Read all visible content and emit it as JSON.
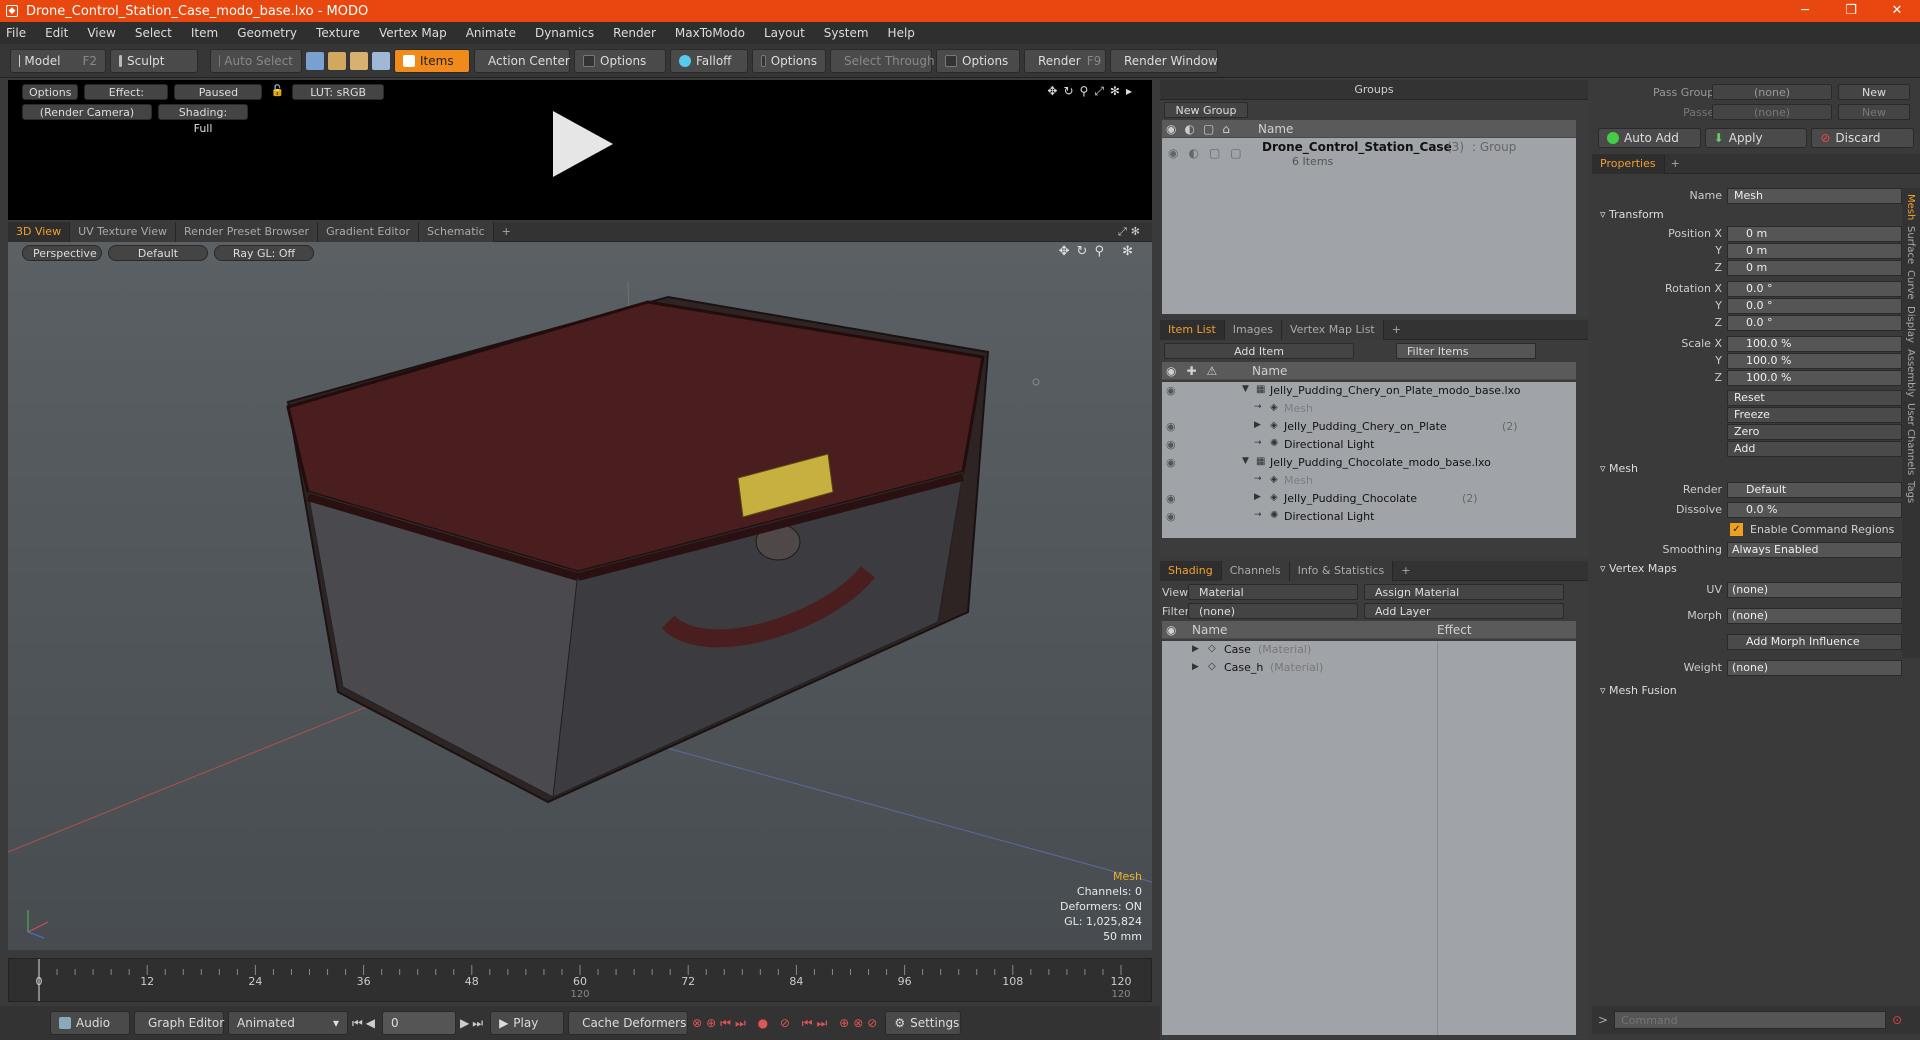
{
  "window": {
    "title": "Drone_Control_Station_Case_modo_base.lxo - MODO",
    "minimize": "─",
    "maximize": "❐",
    "close": "✕"
  },
  "menu": [
    "File",
    "Edit",
    "View",
    "Select",
    "Item",
    "Geometry",
    "Texture",
    "Vertex Map",
    "Animate",
    "Dynamics",
    "Render",
    "MaxToModo",
    "Layout",
    "System",
    "Help"
  ],
  "toolbar": {
    "model": "Model",
    "model_key": "F2",
    "sculpt": "Sculpt",
    "auto_select": "Auto Select",
    "items": "Items",
    "action_center": "Action Center",
    "options1": "Options",
    "falloff": "Falloff",
    "options2": "Options",
    "select_through": "Select Through",
    "options3": "Options",
    "render": "Render",
    "render_key": "F9",
    "render_window": "Render Window"
  },
  "preview": {
    "options": "Options",
    "effect": "Effect: (Shadi...",
    "paused": "Paused",
    "lut": "LUT: sRGB",
    "camera": "(Render Camera)",
    "shading": "Shading: Full"
  },
  "view_tabs": [
    "3D View",
    "UV Texture View",
    "Render Preset Browser",
    "Gradient Editor",
    "Schematic",
    "+"
  ],
  "viewport": {
    "perspective": "Perspective",
    "default": "Default",
    "raygl": "Ray GL: Off",
    "info": {
      "mesh": "Mesh",
      "channels": "Channels: 0",
      "deformers": "Deformers: ON",
      "gl": "GL: 1,025,824",
      "focal": "50 mm"
    }
  },
  "timeline": {
    "ticks": [
      "0",
      "12",
      "24",
      "36",
      "48",
      "60",
      "72",
      "84",
      "96",
      "108",
      "120"
    ],
    "sub_mid": "120",
    "sub_end": "120"
  },
  "bottom": {
    "audio": "Audio",
    "graph_editor": "Graph Editor",
    "animated": "Animated",
    "frame": "0",
    "play": "Play",
    "cache": "Cache Deformers",
    "settings": "Settings"
  },
  "groups": {
    "title": "Groups",
    "new_group": "New Group",
    "col_name": "Name",
    "item_name": "Drone_Control_Station_Case",
    "item_count": "(3)",
    "item_type": ": Group",
    "item_sub": "6 Items"
  },
  "item_list": {
    "tabs": [
      "Item List",
      "Images",
      "Vertex Map List",
      "+"
    ],
    "add_item": "Add Item",
    "filter": "Filter Items",
    "col_name": "Name",
    "rows": [
      {
        "label": "Jelly_Pudding_Chery_on_Plate_modo_base.lxo",
        "level": 0,
        "arrow": "▼",
        "dim": false
      },
      {
        "label": "Mesh",
        "level": 1,
        "arrow": "",
        "dim": true
      },
      {
        "label": "Jelly_Pudding_Chery_on_Plate",
        "suffix": "(2)",
        "level": 1,
        "arrow": "▶",
        "dim": false
      },
      {
        "label": "Directional Light",
        "level": 1,
        "arrow": "",
        "dim": false
      },
      {
        "label": "Jelly_Pudding_Chocolate_modo_base.lxo",
        "level": 0,
        "arrow": "▼",
        "dim": false
      },
      {
        "label": "Mesh",
        "level": 1,
        "arrow": "",
        "dim": true
      },
      {
        "label": "Jelly_Pudding_Chocolate",
        "suffix": "(2)",
        "level": 1,
        "arrow": "▶",
        "dim": false
      },
      {
        "label": "Directional Light",
        "level": 1,
        "arrow": "",
        "dim": false
      }
    ]
  },
  "shading": {
    "tabs": [
      "Shading",
      "Channels",
      "Info & Statistics",
      "+"
    ],
    "view_label": "View",
    "view_value": "Material",
    "assign": "Assign Material",
    "filter_label": "Filter",
    "filter_value": "(none)",
    "add_layer": "Add Layer",
    "col_name": "Name",
    "col_effect": "Effect",
    "rows": [
      {
        "label": "Case",
        "type": "(Material)"
      },
      {
        "label": "Case_h",
        "type": "(Material)"
      }
    ]
  },
  "pass": {
    "pass_groups": "Pass Groups",
    "passes": "Passes",
    "none1": "(none)",
    "none2": "(none)",
    "new1": "New",
    "new2": "New",
    "auto_add": "Auto Add",
    "apply": "Apply",
    "discard": "Discard"
  },
  "properties": {
    "tab": "Properties",
    "name_label": "Name",
    "name_value": "Mesh",
    "transform": "Transform",
    "pos_x": "Position X",
    "y": "Y",
    "z": "Z",
    "pos_val": "0 m",
    "rot_x": "Rotation X",
    "rot_val": "0.0 °",
    "scale_x": "Scale X",
    "scale_val": "100.0 %",
    "reset": "Reset",
    "freeze": "Freeze",
    "zero": "Zero",
    "add": "Add",
    "mesh": "Mesh",
    "render_label": "Render",
    "render_value": "Default",
    "dissolve_label": "Dissolve",
    "dissolve_value": "0.0 %",
    "enable_cmd": "Enable Command Regions",
    "smoothing_label": "Smoothing",
    "smoothing_value": "Always Enabled",
    "vertex_maps": "Vertex Maps",
    "uv_label": "UV",
    "uv_value": "(none)",
    "morph_label": "Morph",
    "morph_value": "(none)",
    "add_morph": "Add Morph Influence",
    "weight_label": "Weight",
    "weight_value": "(none)",
    "mesh_fusion": "Mesh Fusion"
  },
  "side_tabs": [
    "Mesh",
    "Surface",
    "Curve",
    "Display",
    "Assembly",
    "User Channels",
    "Tags"
  ],
  "command": {
    "placeholder": "Command"
  }
}
